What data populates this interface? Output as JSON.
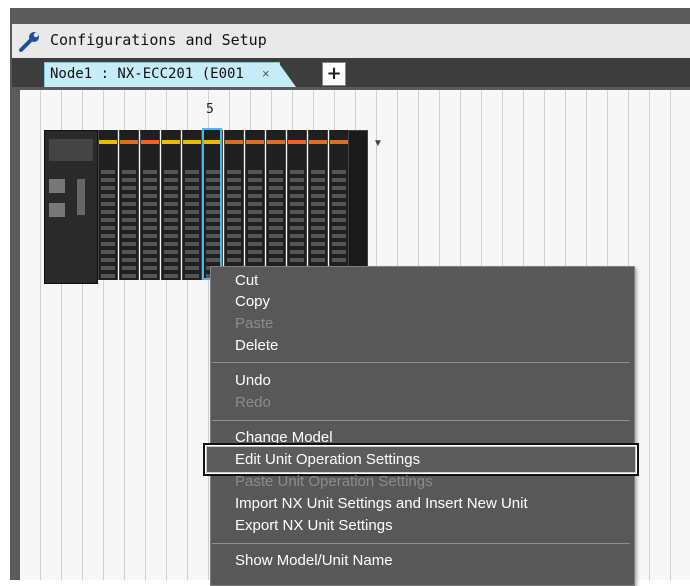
{
  "window": {
    "title": "Configurations and Setup"
  },
  "tabs": [
    {
      "label": "Node1 : NX-ECC201 (E001",
      "close": "×"
    }
  ],
  "add_tab": "+",
  "canvas": {
    "slot_number": "5"
  },
  "context_menu": {
    "items": [
      {
        "label": "Cut",
        "enabled": true
      },
      {
        "label": "Copy",
        "enabled": true
      },
      {
        "label": "Paste",
        "enabled": false
      },
      {
        "label": "Delete",
        "enabled": true
      },
      {
        "label": "Undo",
        "enabled": true
      },
      {
        "label": "Redo",
        "enabled": false
      },
      {
        "label": "Change Model",
        "enabled": true
      },
      {
        "label": "Edit Unit Operation Settings",
        "enabled": true,
        "highlighted": true
      },
      {
        "label": "Paste Unit Operation Settings",
        "enabled": false
      },
      {
        "label": "Import NX Unit Settings and Insert New Unit",
        "enabled": true
      },
      {
        "label": "Export NX Unit Settings",
        "enabled": true
      },
      {
        "label": "Show Model/Unit Name",
        "enabled": true
      }
    ]
  },
  "colors": {
    "selection": "#4db8e8",
    "tab": "#c6ecf7",
    "menu_bg": "#585858"
  }
}
